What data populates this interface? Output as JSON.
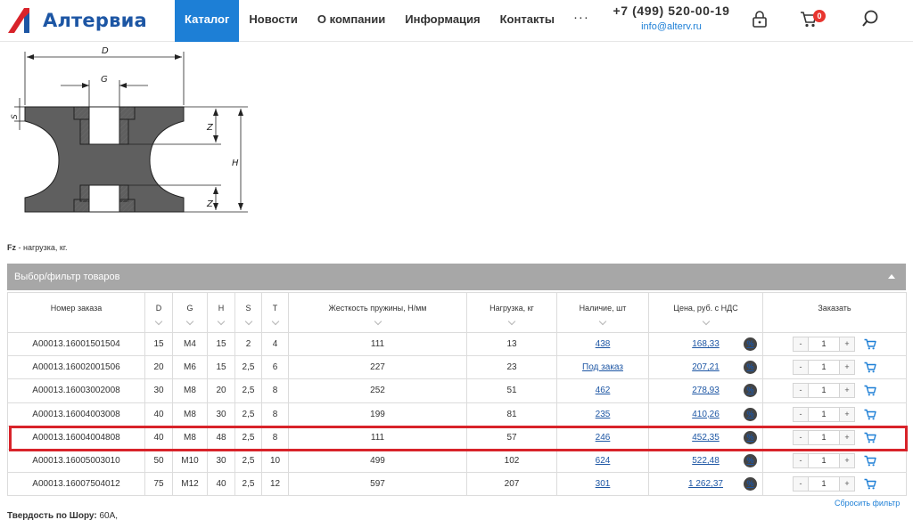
{
  "brand": {
    "name": "Алтервиа",
    "accent": "#1d56a4",
    "mark_color": "#d8232a"
  },
  "nav": {
    "items": [
      {
        "label": "Каталог",
        "active": true
      },
      {
        "label": "Новости",
        "active": false
      },
      {
        "label": "О компании",
        "active": false
      },
      {
        "label": "Информация",
        "active": false
      },
      {
        "label": "Контакты",
        "active": false
      }
    ],
    "more": "···"
  },
  "contacts": {
    "phone": "+7 (499) 520-00-19",
    "email": "info@alterv.ru"
  },
  "header_icons": [
    "lock-icon",
    "cart-icon",
    "search-icon"
  ],
  "cart": {
    "count": "0"
  },
  "drawing": {
    "labels": {
      "D": "D",
      "G": "G",
      "S": "S",
      "Z_top": "Z",
      "H": "H",
      "Z_bottom": "Z"
    }
  },
  "note": {
    "term": "Fz",
    "text": " - нагрузка, кг."
  },
  "filter": {
    "title": "Выбор/фильтр товаров",
    "reset": "Сбросить фильтр"
  },
  "table": {
    "columns": [
      "Номер заказа",
      "D",
      "G",
      "H",
      "S",
      "T",
      "Жесткость пружины, Н/мм",
      "Нагрузка, кг",
      "Наличие, шт",
      "Цена, руб. с НДС",
      "Заказать"
    ],
    "rows": [
      {
        "code": "A00013.16001501504",
        "D": "15",
        "G": "M4",
        "H": "15",
        "S": "2",
        "T": "4",
        "stiffness": "111",
        "load": "13",
        "stock": "438",
        "price": "168,33",
        "qty": "1"
      },
      {
        "code": "A00013.16002001506",
        "D": "20",
        "G": "M6",
        "H": "15",
        "S": "2,5",
        "T": "6",
        "stiffness": "227",
        "load": "23",
        "stock": "Под заказ",
        "price": "207,21",
        "qty": "1"
      },
      {
        "code": "A00013.16003002008",
        "D": "30",
        "G": "M8",
        "H": "20",
        "S": "2,5",
        "T": "8",
        "stiffness": "252",
        "load": "51",
        "stock": "462",
        "price": "278,93",
        "qty": "1"
      },
      {
        "code": "A00013.16004003008",
        "D": "40",
        "G": "M8",
        "H": "30",
        "S": "2,5",
        "T": "8",
        "stiffness": "199",
        "load": "81",
        "stock": "235",
        "price": "410,26",
        "qty": "1"
      },
      {
        "code": "A00013.16004004808",
        "D": "40",
        "G": "M8",
        "H": "48",
        "S": "2,5",
        "T": "8",
        "stiffness": "111",
        "load": "57",
        "stock": "246",
        "price": "452,35",
        "qty": "1"
      },
      {
        "code": "A00013.16005003010",
        "D": "50",
        "G": "M10",
        "H": "30",
        "S": "2,5",
        "T": "10",
        "stiffness": "499",
        "load": "102",
        "stock": "624",
        "price": "522,48",
        "qty": "1"
      },
      {
        "code": "A00013.16007504012",
        "D": "75",
        "G": "M12",
        "H": "40",
        "S": "2,5",
        "T": "12",
        "stiffness": "597",
        "load": "207",
        "stock": "301",
        "price": "1 262,37",
        "qty": "1"
      }
    ],
    "discount_symbol": "%",
    "minus": "-",
    "plus": "+"
  },
  "bottom": {
    "label": "Твердость по Шору:",
    "value": " 60А,"
  }
}
